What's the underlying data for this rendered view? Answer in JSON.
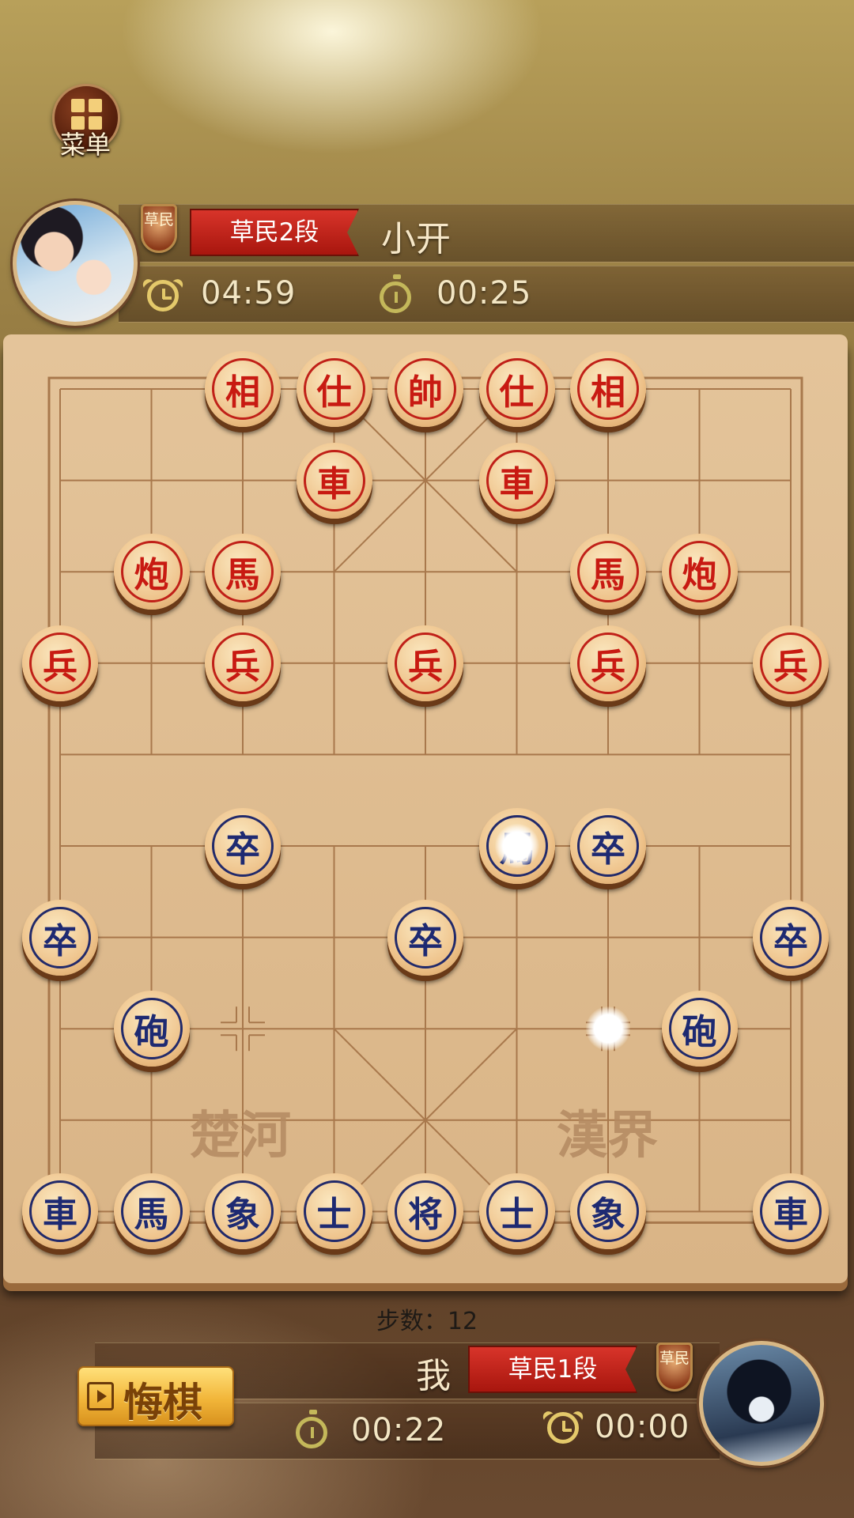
{
  "menu": {
    "label": "菜单"
  },
  "opponent": {
    "name": "小开",
    "rank": "草民2段",
    "badge": "草民",
    "total_time": "04:59",
    "move_time": "00:25"
  },
  "player": {
    "name": "我",
    "rank": "草民1段",
    "badge": "草民",
    "move_time": "00:22",
    "total_time": "00:00"
  },
  "board": {
    "river_left": "楚河",
    "river_right": "漢界",
    "pieces": [
      {
        "side": "red",
        "char": "相",
        "file": 2,
        "rank": 0
      },
      {
        "side": "red",
        "char": "仕",
        "file": 3,
        "rank": 0
      },
      {
        "side": "red",
        "char": "帥",
        "file": 4,
        "rank": 0
      },
      {
        "side": "red",
        "char": "仕",
        "file": 5,
        "rank": 0
      },
      {
        "side": "red",
        "char": "相",
        "file": 6,
        "rank": 0
      },
      {
        "side": "red",
        "char": "車",
        "file": 3,
        "rank": 1
      },
      {
        "side": "red",
        "char": "車",
        "file": 5,
        "rank": 1
      },
      {
        "side": "red",
        "char": "炮",
        "file": 1,
        "rank": 2
      },
      {
        "side": "red",
        "char": "馬",
        "file": 2,
        "rank": 2
      },
      {
        "side": "red",
        "char": "馬",
        "file": 6,
        "rank": 2
      },
      {
        "side": "red",
        "char": "炮",
        "file": 7,
        "rank": 2
      },
      {
        "side": "red",
        "char": "兵",
        "file": 0,
        "rank": 3
      },
      {
        "side": "red",
        "char": "兵",
        "file": 2,
        "rank": 3
      },
      {
        "side": "red",
        "char": "兵",
        "file": 4,
        "rank": 3
      },
      {
        "side": "red",
        "char": "兵",
        "file": 6,
        "rank": 3
      },
      {
        "side": "red",
        "char": "兵",
        "file": 8,
        "rank": 3
      },
      {
        "side": "blue",
        "char": "卒",
        "file": 2,
        "rank": 5
      },
      {
        "side": "blue",
        "char": "馬",
        "file": 5,
        "rank": 5
      },
      {
        "side": "blue",
        "char": "卒",
        "file": 6,
        "rank": 5
      },
      {
        "side": "blue",
        "char": "卒",
        "file": 0,
        "rank": 6
      },
      {
        "side": "blue",
        "char": "卒",
        "file": 4,
        "rank": 6
      },
      {
        "side": "blue",
        "char": "卒",
        "file": 8,
        "rank": 6
      },
      {
        "side": "blue",
        "char": "砲",
        "file": 1,
        "rank": 7
      },
      {
        "side": "blue",
        "char": "砲",
        "file": 7,
        "rank": 7
      },
      {
        "side": "blue",
        "char": "車",
        "file": 0,
        "rank": 9
      },
      {
        "side": "blue",
        "char": "馬",
        "file": 1,
        "rank": 9
      },
      {
        "side": "blue",
        "char": "象",
        "file": 2,
        "rank": 9
      },
      {
        "side": "blue",
        "char": "士",
        "file": 3,
        "rank": 9
      },
      {
        "side": "blue",
        "char": "将",
        "file": 4,
        "rank": 9
      },
      {
        "side": "blue",
        "char": "士",
        "file": 5,
        "rank": 9
      },
      {
        "side": "blue",
        "char": "象",
        "file": 6,
        "rank": 9
      },
      {
        "side": "blue",
        "char": "車",
        "file": 8,
        "rank": 9
      }
    ],
    "highlights": [
      {
        "file": 5,
        "rank": 5
      },
      {
        "file": 6,
        "rank": 7
      }
    ]
  },
  "status": {
    "steps": "步数：12"
  },
  "actions": {
    "undo_label": "悔棋"
  }
}
